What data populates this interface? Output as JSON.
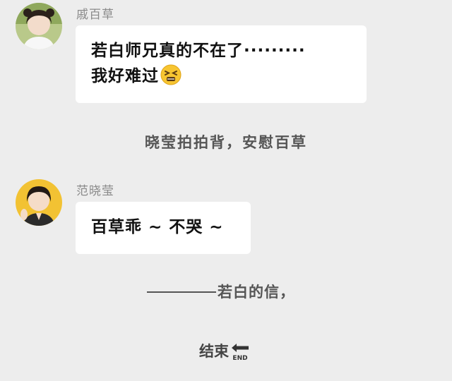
{
  "messages": [
    {
      "sender": "戚百草",
      "lines": [
        "若白师兄真的不在了·········",
        "我好难过"
      ],
      "emoji": "persevering-face-emoji"
    },
    {
      "sender": "范晓莹",
      "lines": [
        "百草乖 ~ 不哭 ~"
      ]
    }
  ],
  "narration": "晓莹拍拍背，安慰百草",
  "letter_text": "若白的信，",
  "end_label": "结束",
  "end_icon_text": "END",
  "colors": {
    "background": "#ededed",
    "bubble": "#ffffff",
    "name_text": "#8a8a8a",
    "narration_text": "#555555"
  }
}
